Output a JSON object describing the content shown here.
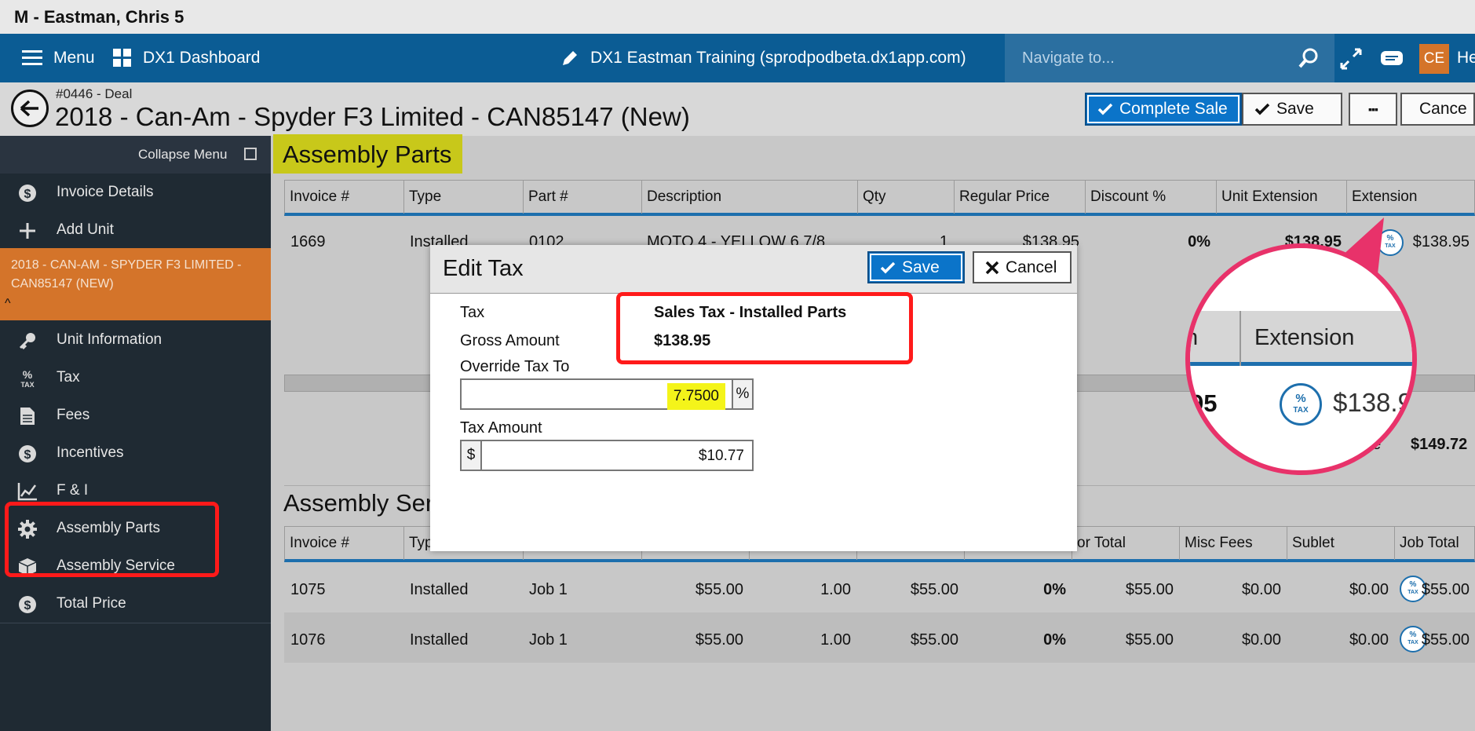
{
  "window": {
    "title": "M - Eastman, Chris 5"
  },
  "topnav": {
    "menu_label": "Menu",
    "dashboard_label": "DX1 Dashboard",
    "environment_label": "DX1 Eastman Training (sprodpodbeta.dx1app.com)",
    "search_placeholder": "Navigate to...",
    "user_initials": "CE",
    "help_label": "He"
  },
  "deal": {
    "number": "#0446 - Deal",
    "title": "2018 - Can-Am - Spyder F3 Limited - CAN85147 (New)",
    "actions": {
      "complete_sale": "Complete Sale",
      "save": "Save",
      "more": "▪▪▪",
      "cancel": "Cance"
    }
  },
  "sidebar": {
    "collapse_label": "Collapse Menu",
    "items_top": [
      {
        "label": "Invoice Details",
        "icon": "dollar-circle-icon"
      },
      {
        "label": "Add Unit",
        "icon": "plus-icon"
      }
    ],
    "active_unit": "2018 - CAN-AM - SPYDER F3 LIMITED - CAN85147 (NEW)",
    "items": [
      {
        "label": "Unit Information",
        "icon": "key-icon"
      },
      {
        "label": "Tax",
        "icon": "percent-tax-icon"
      },
      {
        "label": "Fees",
        "icon": "document-icon"
      },
      {
        "label": "Incentives",
        "icon": "dollar-circle-icon"
      },
      {
        "label": "F & I",
        "icon": "chart-icon"
      },
      {
        "label": "Assembly Parts",
        "icon": "gear-icon"
      },
      {
        "label": "Assembly Service",
        "icon": "box-icon"
      },
      {
        "label": "Total Price",
        "icon": "dollar-circle-icon"
      }
    ]
  },
  "parts": {
    "title": "Assembly Parts",
    "columns": [
      "Invoice #",
      "Type",
      "Part #",
      "Description",
      "Qty",
      "Regular Price",
      "Discount %",
      "Unit Extension",
      "Extension"
    ],
    "row": {
      "invoice": "1669",
      "type": "Installed",
      "part": "0102",
      "description": "MOTO 4 - YELLOW 6 7/8",
      "qty": "1",
      "regular_price": "$138.95",
      "discount": "0%",
      "unit_extension": "$138.95",
      "extension": "$138.95"
    },
    "total_price_label": "rice",
    "total_price_value": "$149.72"
  },
  "service": {
    "title": "Assembly Ser",
    "columns": [
      "Invoice #",
      "Typ",
      "",
      "",
      "",
      "",
      "",
      "or Total",
      "Misc Fees",
      "Sublet",
      "Job Total"
    ],
    "rows": [
      {
        "invoice": "1075",
        "type": "Installed",
        "job": "Job 1",
        "rate": "$55.00",
        "hours": "1.00",
        "labor": "$55.00",
        "discount": "0%",
        "labor_total": "$55.00",
        "misc": "$0.00",
        "sublet": "$0.00",
        "job_total": "$55.00"
      },
      {
        "invoice": "1076",
        "type": "Installed",
        "job": "Job 1",
        "rate": "$55.00",
        "hours": "1.00",
        "labor": "$55.00",
        "discount": "0%",
        "labor_total": "$55.00",
        "misc": "$0.00",
        "sublet": "$0.00",
        "job_total": "$55.00"
      }
    ]
  },
  "modal": {
    "title": "Edit Tax",
    "save_label": "Save",
    "cancel_label": "Cancel",
    "tax_label": "Tax",
    "tax_value": "Sales Tax - Installed Parts",
    "gross_label": "Gross Amount",
    "gross_value": "$138.95",
    "override_label": "Override Tax To",
    "override_value": "7.7500",
    "override_suffix": "%",
    "tax_amount_label": "Tax Amount",
    "tax_amount_prefix": "$",
    "tax_amount_value": "$10.77"
  },
  "magnifier": {
    "partial_header": "n",
    "header": "Extension",
    "partial_value": "95",
    "value": "$138.9",
    "tax_icon_text_top": "%",
    "tax_icon_text_bottom": "TAX"
  },
  "colors": {
    "nav": "#0b5c94",
    "accent": "#0b74c9",
    "unit_highlight": "#d4742a",
    "annotation_red": "#ff1a1a",
    "callout_pink": "#e8326a",
    "yellow_highlight": "#f4f41a"
  }
}
